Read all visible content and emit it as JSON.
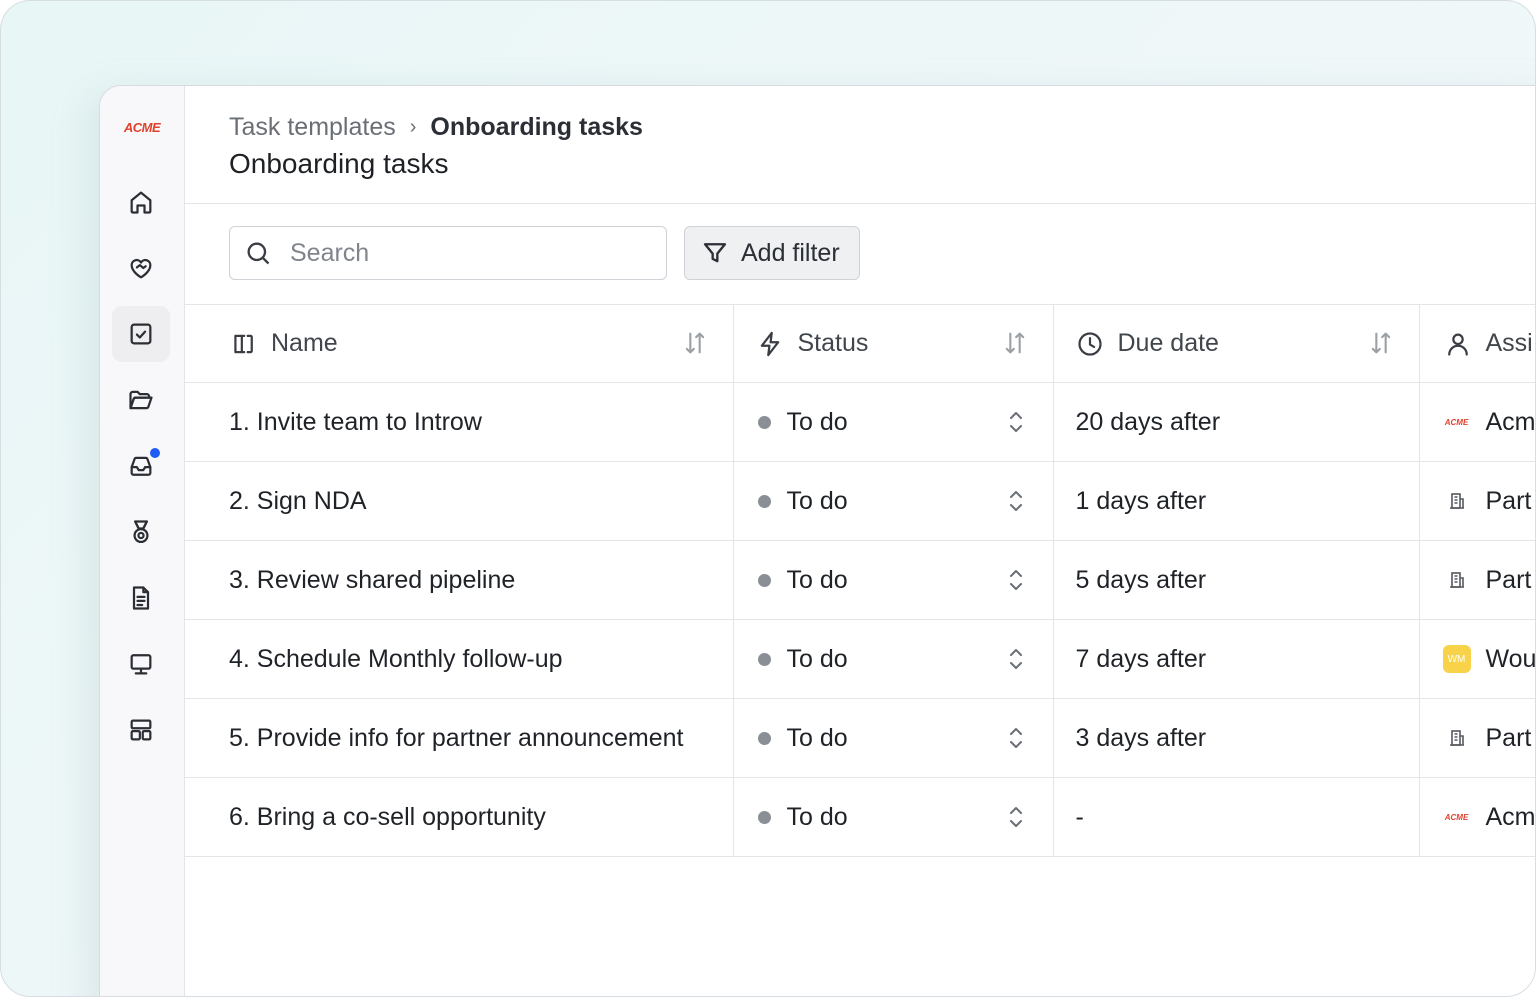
{
  "brand": {
    "logo_text": "ACME",
    "logo_color": "#e0412f"
  },
  "breadcrumb": {
    "parent": "Task templates",
    "separator": "›",
    "current": "Onboarding tasks"
  },
  "page": {
    "title": "Onboarding tasks"
  },
  "search": {
    "placeholder": "Search",
    "value": ""
  },
  "toolbar": {
    "filter_label": "Add filter"
  },
  "sidebar": {
    "items": [
      {
        "name": "home",
        "icon": "home-icon",
        "active": false
      },
      {
        "name": "partners",
        "icon": "handshake-heart-icon",
        "active": false
      },
      {
        "name": "tasks",
        "icon": "checkbox-icon",
        "active": true
      },
      {
        "name": "files",
        "icon": "folder-open-icon",
        "active": false
      },
      {
        "name": "inbox",
        "icon": "inbox-icon",
        "active": false,
        "notification": true
      },
      {
        "name": "rewards",
        "icon": "medal-icon",
        "active": false
      },
      {
        "name": "documents",
        "icon": "document-icon",
        "active": false
      },
      {
        "name": "resources",
        "icon": "monitor-icon",
        "active": false
      },
      {
        "name": "templates",
        "icon": "layout-icon",
        "active": false
      }
    ],
    "notification_color": "#1f5cf5"
  },
  "table": {
    "columns": {
      "name": "Name",
      "status": "Status",
      "due": "Due date",
      "assignee": "Assi"
    },
    "rows": [
      {
        "name": "1. Invite team to Introw",
        "status": "To do",
        "due": "20 days after",
        "assignee": "Acm",
        "assignee_icon": "acme-logo",
        "assignee_logo_text": "ACME"
      },
      {
        "name": "2. Sign NDA",
        "status": "To do",
        "due": "1 days after",
        "assignee": "Part",
        "assignee_icon": "building-icon"
      },
      {
        "name": "3. Review shared pipeline",
        "status": "To do",
        "due": "5 days after",
        "assignee": "Part",
        "assignee_icon": "building-icon"
      },
      {
        "name": "4. Schedule Monthly follow-up",
        "status": "To do",
        "due": "7 days after",
        "assignee": "Wou",
        "assignee_icon": "wm-badge",
        "assignee_logo_text": "WM"
      },
      {
        "name": "5. Provide info for partner announcement",
        "status": "To do",
        "due": "3 days after",
        "assignee": "Part",
        "assignee_icon": "building-icon"
      },
      {
        "name": "6. Bring a co-sell opportunity",
        "status": "To do",
        "due": "-",
        "assignee": "Acm",
        "assignee_icon": "acme-logo",
        "assignee_logo_text": "ACME"
      }
    ]
  }
}
